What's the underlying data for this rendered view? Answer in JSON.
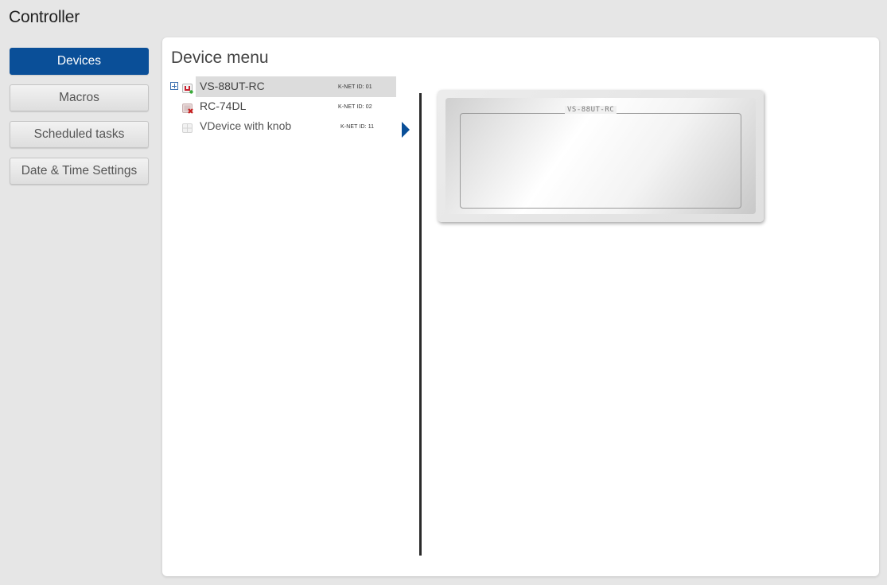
{
  "app": {
    "title": "Controller"
  },
  "nav": {
    "items": [
      {
        "label": "Devices",
        "active": true
      },
      {
        "label": "Macros",
        "active": false
      },
      {
        "label": "Scheduled tasks",
        "active": false
      },
      {
        "label": "Date & Time Settings",
        "active": false
      }
    ]
  },
  "panel": {
    "title": "Device menu"
  },
  "tree": {
    "devices": [
      {
        "name": "VS-88UT-RC",
        "knet": "K-NET ID: 01",
        "selected": true,
        "expandable": true,
        "icon": "device-online-icon"
      },
      {
        "name": "RC-74DL",
        "knet": "K-NET ID: 02",
        "selected": false,
        "expandable": false,
        "icon": "device-error-icon"
      },
      {
        "name": "VDevice with knob",
        "knet": "K-NET ID: 11",
        "selected": false,
        "expandable": false,
        "icon": "device-virtual-icon"
      }
    ]
  },
  "preview": {
    "device_label": "VS-88UT-RC"
  },
  "colors": {
    "accent": "#0a4f98",
    "background": "#e6e6e6",
    "panel": "#ffffff"
  }
}
